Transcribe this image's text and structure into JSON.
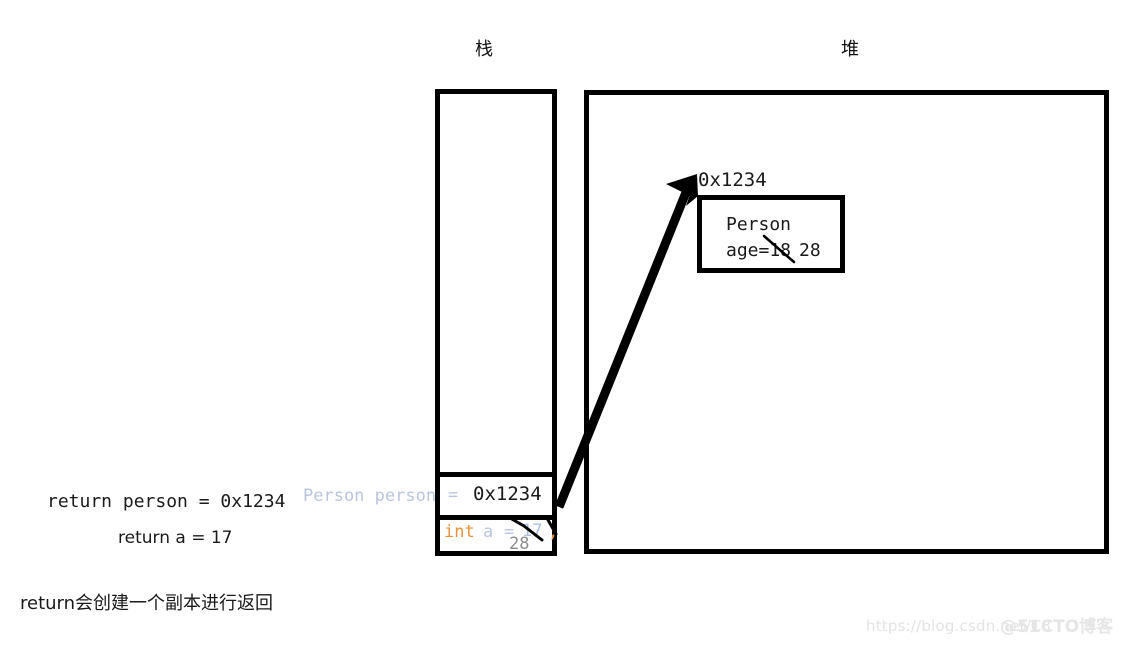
{
  "diagram": {
    "stack_title": "栈",
    "heap_title": "堆",
    "bottom_note": "return会创建一个副本进行返回"
  },
  "stack": {
    "cells": [
      {
        "id": "person-slot",
        "declaration": "Person person",
        "equals": "=",
        "value": "0x1234"
      },
      {
        "id": "int-slot",
        "keyword": "int",
        "variable": "a",
        "equals": "=",
        "old_value": "17",
        "semicolon": ";",
        "new_value": "28"
      }
    ]
  },
  "heap": {
    "address": "0x1234",
    "object": {
      "class_name": "Person",
      "field_line": "age=18",
      "old_field_value": "18",
      "new_field_value": "28"
    }
  },
  "returns": [
    {
      "text": "return person = 0x1234"
    },
    {
      "text": "return a = 17"
    }
  ],
  "watermarks": {
    "csdn": "https://blog.csdn.net/C3",
    "cto": "@51CTO博客"
  },
  "colors": {
    "stroke": "#000000",
    "keyword_orange": "#e8923a",
    "identifier_blue": "#b9c5dd",
    "literal_blue": "#aac0e2",
    "strikeout_gray": "#8d8d8d",
    "text_black": "#1a1a1a",
    "watermark_gray": "#e3e3e3"
  }
}
